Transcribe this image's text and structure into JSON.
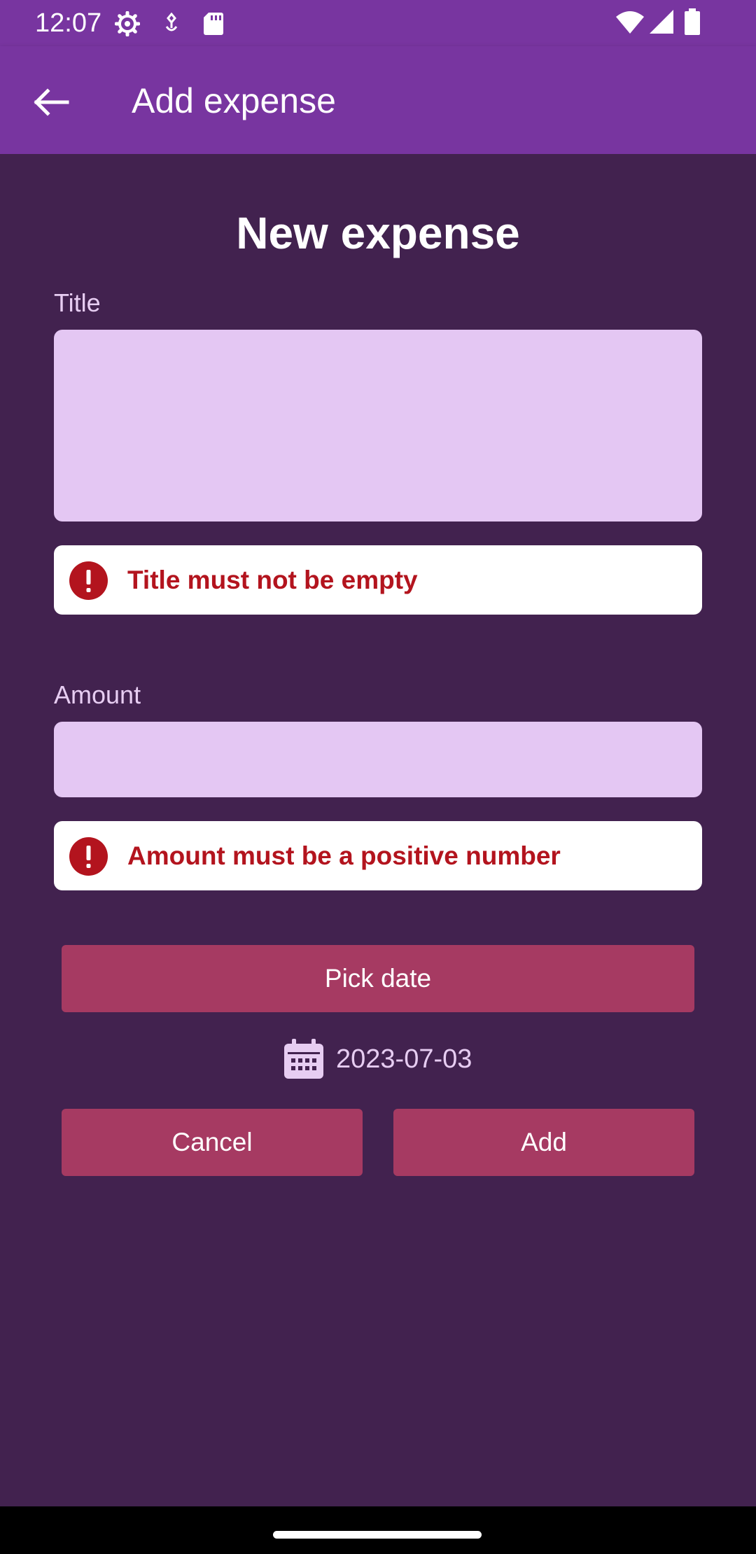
{
  "status_bar": {
    "time": "12:07",
    "icons": [
      "settings-gear-icon",
      "usb-debug-icon",
      "sd-card-icon",
      "wifi-icon",
      "cell-signal-icon",
      "battery-icon"
    ]
  },
  "app_bar": {
    "back_icon": "arrow-back-icon",
    "title": "Add expense"
  },
  "form": {
    "heading": "New expense",
    "title_field": {
      "label": "Title",
      "value": "",
      "placeholder": ""
    },
    "title_error": {
      "icon": "error-icon",
      "message": "Title must not be empty"
    },
    "amount_field": {
      "label": "Amount",
      "value": "",
      "placeholder": ""
    },
    "amount_error": {
      "icon": "error-icon",
      "message": "Amount must be a positive number"
    },
    "pick_date_label": "Pick date",
    "date": {
      "icon": "calendar-icon",
      "value": "2023-07-03"
    },
    "cancel_label": "Cancel",
    "add_label": "Add"
  },
  "colors": {
    "app_bar": "#7835A0",
    "background": "#42224F",
    "field_fill": "#E4C7F3",
    "button": "#A63A62",
    "error_text": "#B3141E",
    "label_text": "#E7CDF2"
  }
}
